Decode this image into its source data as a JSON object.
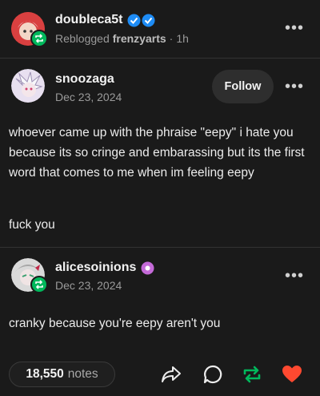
{
  "reblogger": {
    "name": "doubleca5t",
    "reblogged_prefix": "Reblogged",
    "reblogged_from": "frenzyarts",
    "time": "1h"
  },
  "post1": {
    "author": "snoozaga",
    "date": "Dec 23, 2024",
    "follow_label": "Follow",
    "paragraphs": [
      "whoever came up with the phraise \"eepy\" i hate you because its so cringe and embarassing but its the first word that comes to me when im feeling eepy",
      "fuck you"
    ]
  },
  "post2": {
    "author": "alicesoinions",
    "date": "Dec 23, 2024",
    "text": "cranky because you're eepy aren't you"
  },
  "footer": {
    "notes_count": "18,550",
    "notes_label": "notes"
  },
  "colors": {
    "background": "#1a1a1a",
    "verified_blue": "#1e8cf5",
    "reblog_green": "#00b85c",
    "like_red": "#ff4930"
  }
}
